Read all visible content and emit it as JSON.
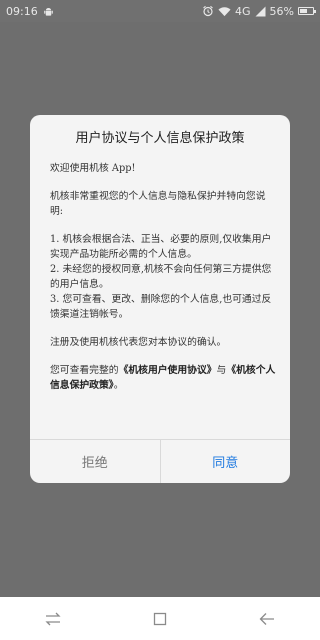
{
  "status_bar": {
    "time": "09:16",
    "network": "4G",
    "battery_percent": "56%",
    "battery_level": 0.56,
    "icons": [
      "android-robot-icon",
      "alarm-icon",
      "wifi-icon",
      "signal-icon",
      "battery-icon"
    ]
  },
  "dialog": {
    "title": "用户协议与个人信息保护政策",
    "greeting": "欢迎使用机核 App!",
    "intro": "机核非常重视您的个人信息与隐私保护并特向您说明:",
    "points": [
      "1. 机核会根据合法、正当、必要的原则,仅收集用户实现产品功能所必需的个人信息。",
      "2. 未经您的授权同意,机核不会向任何第三方提供您的用户信息。",
      "3. 您可查看、更改、删除您的个人信息,也可通过反馈渠道注销帐号。"
    ],
    "consent_note": "注册及使用机核代表您对本协议的确认。",
    "link_prefix": "您可查看完整的",
    "link_user_agreement": "《机核用户使用协议》",
    "link_joiner": "与",
    "link_privacy_policy": "《机核个人信息保护政策》",
    "link_suffix": "。",
    "reject_label": "拒绝",
    "agree_label": "同意",
    "colors": {
      "agree": "#1f7ae0",
      "reject": "#777777"
    }
  },
  "nav_bar": {
    "icons": [
      "switch-arrows-icon",
      "square-home-icon",
      "back-arrow-icon"
    ]
  }
}
